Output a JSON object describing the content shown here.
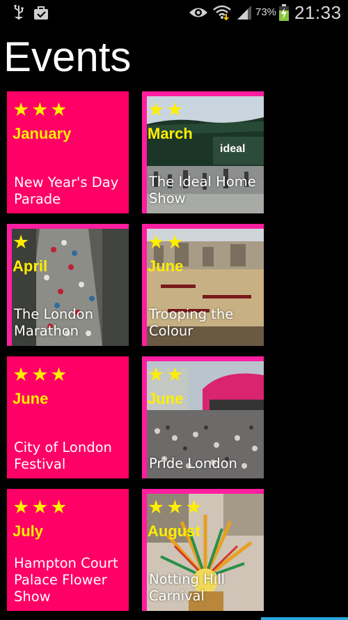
{
  "status_bar": {
    "battery": "73%",
    "time": "21:33",
    "icons": [
      "usb-icon",
      "shopping-bag-icon",
      "eye-icon",
      "wifi-icon",
      "signal-icon",
      "battery-charging-icon"
    ]
  },
  "title": "Events",
  "colors": {
    "tile": "#ff0066",
    "accent_border": "#ff1ea0",
    "stars": "#ffee00",
    "scroll": "#2aa6dc"
  },
  "events": [
    {
      "stars": "★★★",
      "rating": 3,
      "month": "January",
      "name": "New Year's Day Parade",
      "has_photo": false
    },
    {
      "stars": "★★",
      "rating": 2,
      "month": "March",
      "name": "The Ideal Home Show",
      "has_photo": true,
      "photo_text": "ideal"
    },
    {
      "stars": "★",
      "rating": 1,
      "month": "April",
      "name": "The London Marathon",
      "has_photo": true
    },
    {
      "stars": "★★",
      "rating": 2,
      "month": "June",
      "name": "Trooping the Colour",
      "has_photo": true
    },
    {
      "stars": "★★★",
      "rating": 3,
      "month": "June",
      "name": "City of London Festival",
      "has_photo": false
    },
    {
      "stars": "★★",
      "rating": 2,
      "month": "June",
      "name": "Pride London",
      "has_photo": true
    },
    {
      "stars": "★★★",
      "rating": 3,
      "month": "July",
      "name": "Hampton Court Palace Flower Show",
      "has_photo": false
    },
    {
      "stars": "★★★",
      "rating": 3,
      "month": "August",
      "name": "Notting Hill Carnival",
      "has_photo": true
    }
  ]
}
